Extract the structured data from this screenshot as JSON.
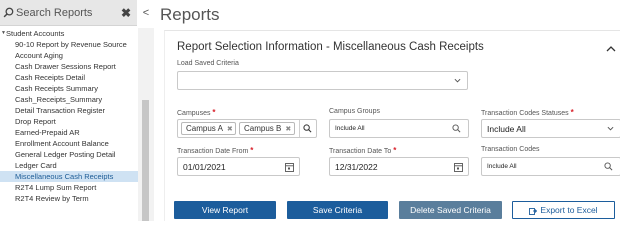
{
  "sidebar": {
    "search_placeholder": "Search Reports",
    "clear_label": "✖",
    "collapse_label": "<",
    "group_label": "Student Accounts",
    "items": [
      {
        "label": "90-10 Report by Revenue Source",
        "selected": false
      },
      {
        "label": "Account Aging",
        "selected": false
      },
      {
        "label": "Cash Drawer Sessions Report",
        "selected": false
      },
      {
        "label": "Cash Receipts Detail",
        "selected": false
      },
      {
        "label": "Cash Receipts Summary",
        "selected": false
      },
      {
        "label": "Cash_Receipts_Summary",
        "selected": false
      },
      {
        "label": "Detail Transaction Register",
        "selected": false
      },
      {
        "label": "Drop Report",
        "selected": false
      },
      {
        "label": "Earned-Prepaid AR",
        "selected": false
      },
      {
        "label": "Enrollment Account Balance",
        "selected": false
      },
      {
        "label": "General Ledger Posting Detail",
        "selected": false
      },
      {
        "label": "Ledger Card",
        "selected": false
      },
      {
        "label": "Miscellaneous Cash Receipts",
        "selected": true
      },
      {
        "label": "R2T4 Lump Sum Report",
        "selected": false
      },
      {
        "label": "R2T4 Review by Term",
        "selected": false
      }
    ]
  },
  "main": {
    "page_title": "Reports",
    "panel_title": "Report Selection Information - Miscellaneous Cash Receipts",
    "load_saved_criteria": {
      "label": "Load Saved Criteria",
      "value": ""
    },
    "campuses": {
      "label": "Campuses",
      "required_mark": "*",
      "chips": [
        "Campus A",
        "Campus B"
      ],
      "chip_remove": "✖"
    },
    "campus_groups": {
      "label": "Campus Groups",
      "value": "Include All"
    },
    "transaction_codes_statuses": {
      "label": "Transaction Codes Statuses",
      "required_mark": "*",
      "value": "Include All"
    },
    "transaction_date_from": {
      "label": "Transaction Date From",
      "required_mark": "*",
      "value": "01/01/2021"
    },
    "transaction_date_to": {
      "label": "Transaction Date To",
      "required_mark": "*",
      "value": "12/31/2022"
    },
    "transaction_codes": {
      "label": "Transaction Codes",
      "value": "Include All"
    },
    "buttons": {
      "view_report": "View Report",
      "save_criteria": "Save Criteria",
      "delete_saved_criteria": "Delete Saved Criteria",
      "export_to_excel": "Export to Excel"
    }
  },
  "colors": {
    "primary": "#1c5d9c",
    "secondary": "#5a7e9c",
    "required": "#d9232d",
    "selected_bg": "#cfe2f3"
  }
}
